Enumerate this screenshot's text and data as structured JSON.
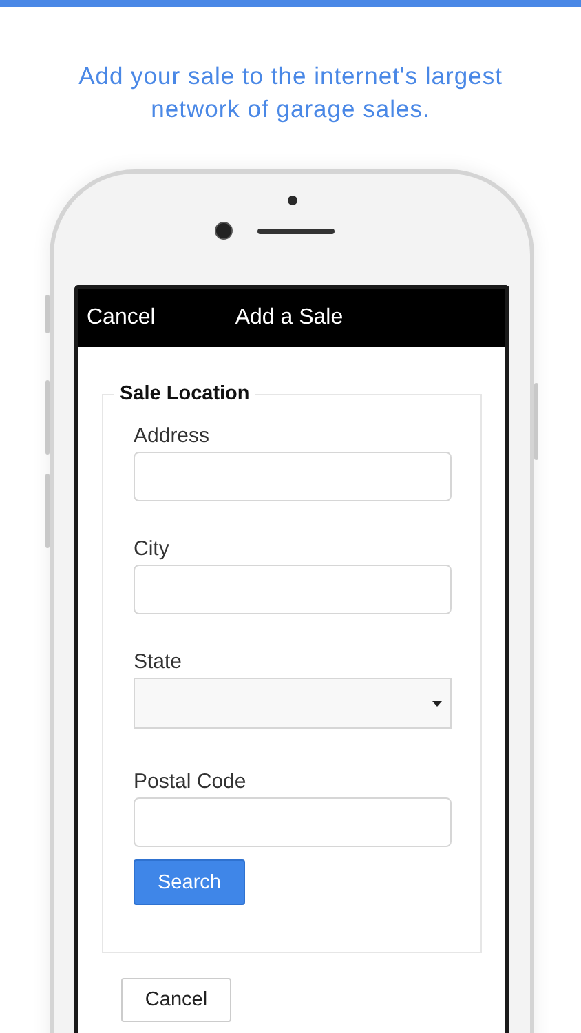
{
  "headline": "Add your sale to the internet's largest network of garage sales.",
  "nav_bar": {
    "left_button": "Cancel",
    "title": "Add a Sale"
  },
  "fieldset": {
    "legend": "Sale Location",
    "fields": [
      {
        "kind": "text",
        "label": "Address"
      },
      {
        "kind": "text",
        "label": "City"
      },
      {
        "kind": "select",
        "label": "State"
      },
      {
        "kind": "text",
        "label": "Postal Code"
      }
    ],
    "submit_button": "Search"
  },
  "cancel_button": "Cancel"
}
